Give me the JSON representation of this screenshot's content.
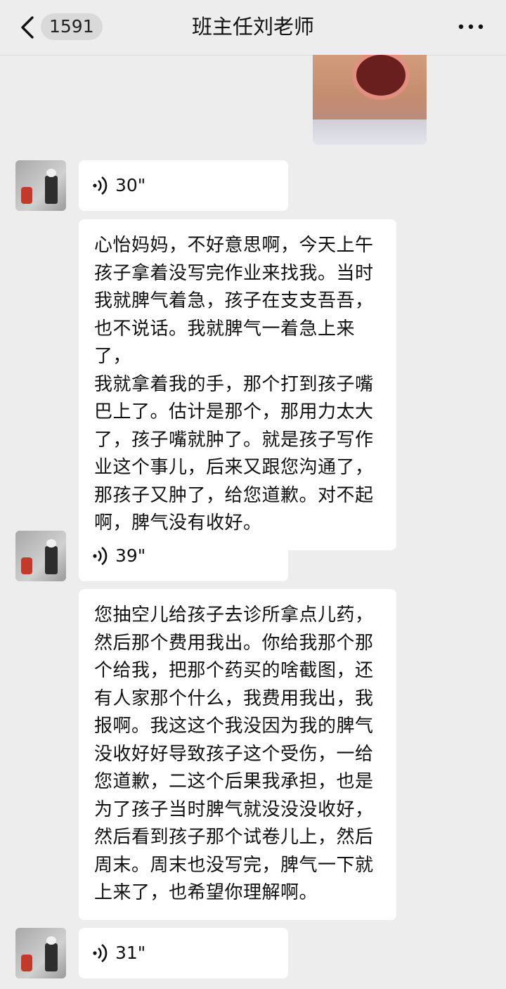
{
  "header": {
    "unread_count": "1591",
    "title": "班主任刘老师",
    "more_icon": "more-dots-icon"
  },
  "messages": [
    {
      "type": "image",
      "from": "self"
    },
    {
      "type": "voice",
      "duration": "30\""
    },
    {
      "type": "text",
      "content": "心怡妈妈，不好意思啊，今天上午\n孩子拿着没写完作业来找我。当时\n我就脾气着急，孩子在支支吾吾，\n也不说话。我就脾气一着急上来了，\n我就拿着我的手，那个打到孩子嘴\n巴上了。估计是那个，那用力太大\n了，孩子嘴就肿了。就是孩子写作\n业这个事儿，后来又跟您沟通了，\n那孩子又肿了，给您道歉。对不起\n啊，脾气没有收好。"
    },
    {
      "type": "voice",
      "duration": "39\""
    },
    {
      "type": "text",
      "content": "您抽空儿给孩子去诊所拿点儿药，\n然后那个费用我出。你给我那个那\n个给我，把那个药买的啥截图，还\n有人家那个什么，我费用我出，我\n报啊。我这这个我没因为我的脾气\n没收好好导致孩子这个受伤，一给\n您道歉，二这个后果我承担，也是\n为了孩子当时脾气就没没没收好，\n然后看到孩子那个试卷儿上，然后\n周末。周末也没写完，脾气一下就\n上来了，也希望你理解啊。"
    },
    {
      "type": "voice",
      "duration": "31\""
    }
  ]
}
